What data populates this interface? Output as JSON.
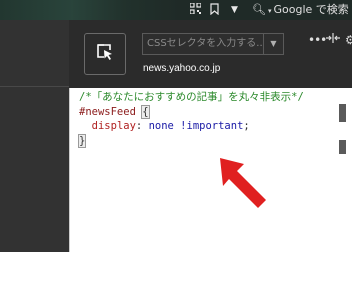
{
  "toolbar": {
    "icons": [
      "qr-code-icon",
      "bookmark-icon",
      "dropdown-icon",
      "search-icon"
    ],
    "search_placeholder": "Google で検索"
  },
  "popup": {
    "pick_button_icon": "element-picker-icon",
    "css_input_placeholder": "CSSセレクタを入力する...",
    "dropdown_icon": "chevron-down-icon",
    "domain": "news.yahoo.co.jp",
    "icons": [
      "more-icon",
      "resize-icon",
      "settings-icon"
    ]
  },
  "editor": {
    "comment": "/*「あなたにおすすめの記事」を丸々非表示*/",
    "selector": "#newsFeed",
    "open_brace": "{",
    "property": "display",
    "colon": ":",
    "value": "none !important",
    "semicolon": ";",
    "close_brace": "}"
  },
  "colors": {
    "toolbar_bg": "#1f2a27",
    "popup_bg": "#2b2b2b",
    "page_bg": "#323232",
    "comment": "#2c8a2c",
    "selector": "#8b1a1a",
    "value": "#1a1aa6",
    "arrow": "#e02020"
  }
}
